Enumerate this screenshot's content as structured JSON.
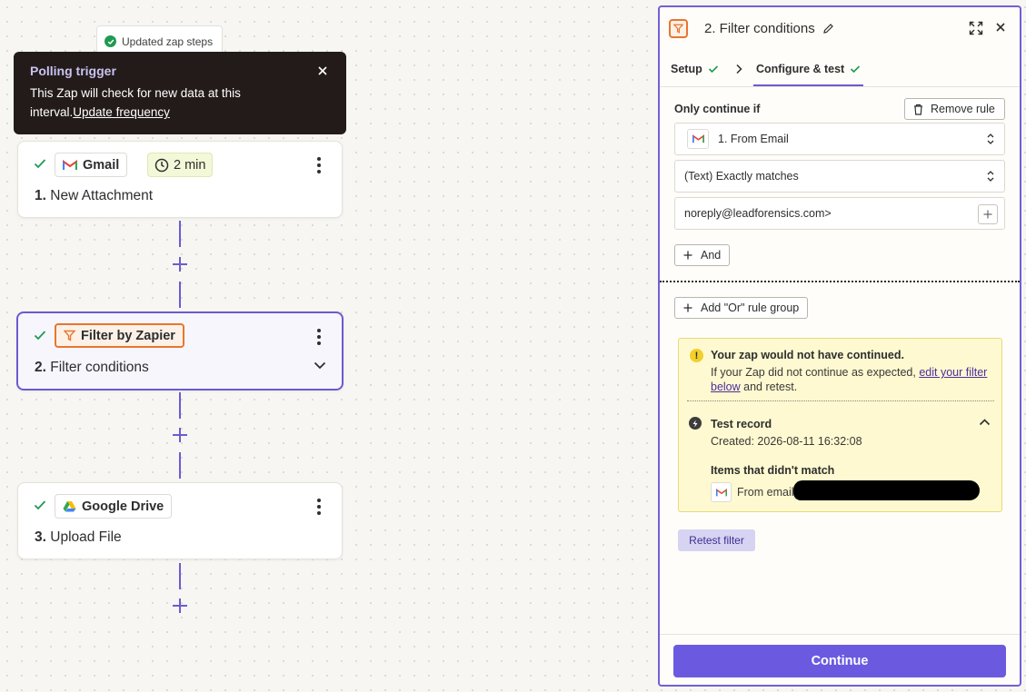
{
  "toast": {
    "text": "Updated zap steps",
    "icon": "check-circle-icon",
    "color": "#1f9a50"
  },
  "tooltip": {
    "title": "Polling trigger",
    "body": "This Zap will check for new data at this interval.",
    "link": "Update frequency"
  },
  "steps": [
    {
      "number": "1.",
      "name": "New Attachment",
      "app": "Gmail",
      "time": "2 min",
      "status": "complete"
    },
    {
      "number": "2.",
      "name": "Filter conditions",
      "app": "Filter by Zapier",
      "status": "complete",
      "selected": true
    },
    {
      "number": "3.",
      "name": "Upload File",
      "app": "Google Drive",
      "status": "complete"
    }
  ],
  "panel": {
    "title": "2. Filter conditions",
    "tabs": [
      {
        "label": "Setup",
        "complete": true
      },
      {
        "label": "Configure & test",
        "complete": true,
        "active": true
      }
    ],
    "only_continue_label": "Only continue if",
    "remove_rule_label": "Remove rule",
    "rule": {
      "field": "1. From Email",
      "operator": "(Text) Exactly matches",
      "value": "noreply@leadforensics.com>"
    },
    "and_label": "And",
    "or_label": "Add \"Or\" rule group",
    "warning": {
      "title": "Your zap would not have continued.",
      "text_before": "If your Zap did not continue as expected, ",
      "link": "edit your filter below",
      "text_after": " and retest."
    },
    "test_record": {
      "title": "Test record",
      "created": "Created: 2026-08-11 16:32:08",
      "nomatch_title": "Items that didn't match",
      "from_label": "From email"
    },
    "retest_label": "Retest filter",
    "continue_label": "Continue"
  },
  "colors": {
    "accent": "#6b5ae0",
    "filter_orange": "#e8762f",
    "warning_bg": "#fef9d0",
    "success": "#1f9a50"
  }
}
